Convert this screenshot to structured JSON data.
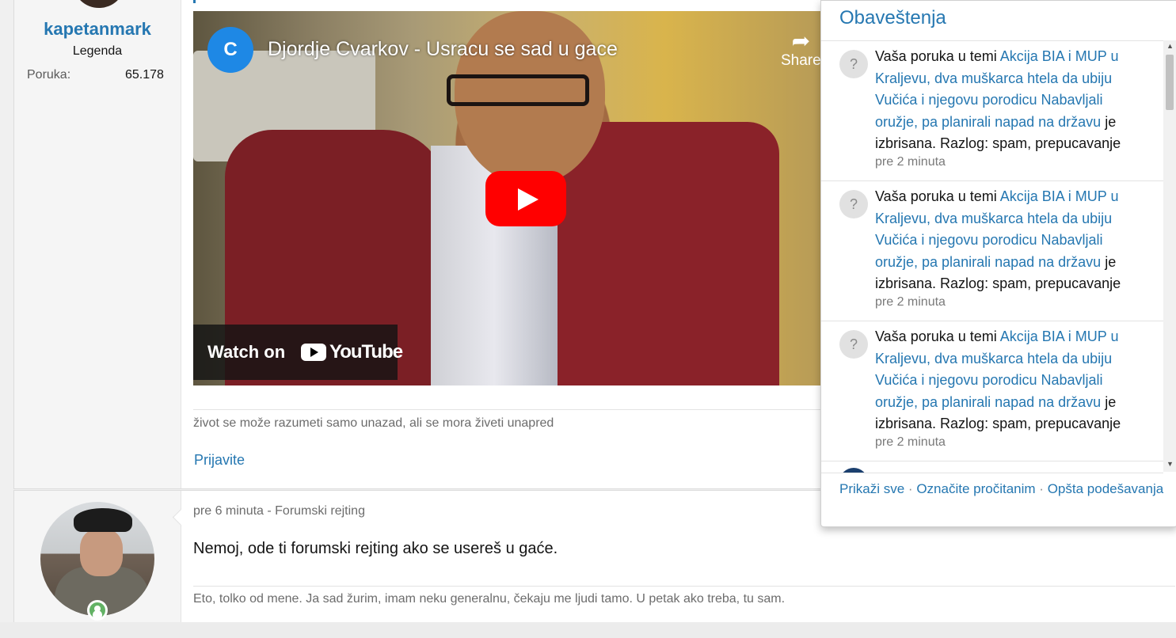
{
  "post1": {
    "username": "kapetanmark",
    "user_title": "Legenda",
    "stat_label": "Poruka:",
    "stat_value": "65.178",
    "video": {
      "channel_letter": "C",
      "title": "Djordje Cvarkov - Usracu se sad u gace",
      "share_label": "Share",
      "watch_on": "Watch on",
      "youtube": "YouTube"
    },
    "signature": "život se može razumeti samo unazad, ali se mora živeti unapred",
    "report_label": "Prijavite"
  },
  "post2": {
    "meta": "pre 6 minuta - Forumski rejting",
    "body": "Nemoj, ode ti forumski rejting ako se usereš u gaće.",
    "signature": "Eto, tolko od mene. Ja sad žurim, imam neku generalnu, čekaju me ljudi tamo. U petak ako treba, tu sam."
  },
  "notifications": {
    "title": "Obaveštenja",
    "items": [
      {
        "avatar": "?",
        "prefix": "Vaša poruka u temi",
        "thread": "Akcija BIA i MUP u Kraljevu, dva muškarca htela da ubiju Vučića i njegovu porodicu Nabavljali oružje, pa planirali napad na državu",
        "suffix": "je izbrisana. Razlog: spam, prepucavanje",
        "time": "pre 2 minuta"
      },
      {
        "avatar": "?",
        "prefix": "Vaša poruka u temi",
        "thread": "Akcija BIA i MUP u Kraljevu, dva muškarca htela da ubiju Vučića i njegovu porodicu Nabavljali oružje, pa planirali napad na državu",
        "suffix": "je izbrisana. Razlog: spam, prepucavanje",
        "time": "pre 2 minuta"
      },
      {
        "avatar": "?",
        "prefix": "Vaša poruka u temi",
        "thread": "Akcija BIA i MUP u Kraljevu, dva muškarca htela da ubiju Vučića i njegovu porodicu Nabavljali oružje, pa planirali napad na državu",
        "suffix": "je izbrisana. Razlog: spam, prepucavanje",
        "time": "pre 2 minuta"
      }
    ],
    "footer": {
      "show_all": "Prikaži sve",
      "separator": "·",
      "mark_read": "Označite pročitanim",
      "settings": "Opšta podešavanja"
    }
  },
  "colors": {
    "link": "#2577b1",
    "youtube_red": "#ff0000",
    "online": "#63b265"
  }
}
